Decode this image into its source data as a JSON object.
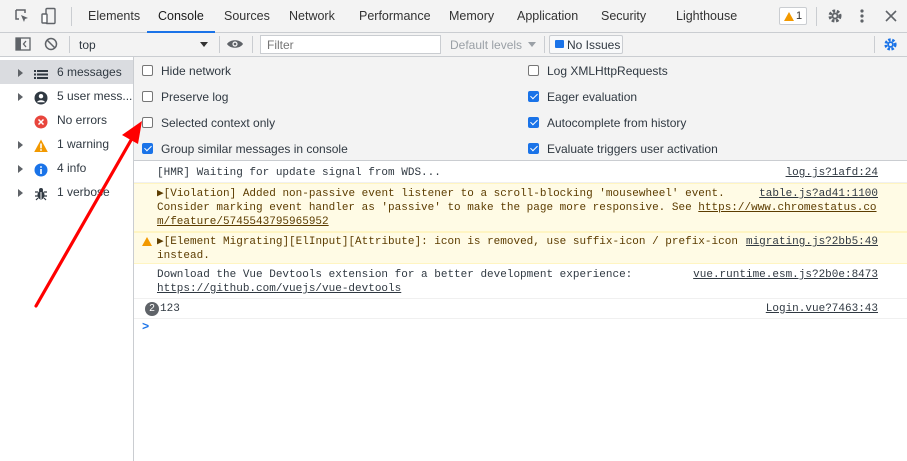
{
  "tabs": [
    "Elements",
    "Console",
    "Sources",
    "Network",
    "Performance",
    "Memory",
    "Application",
    "Security",
    "Lighthouse"
  ],
  "active_tab": "Console",
  "issues_badge": "1",
  "toolbar": {
    "context": "top",
    "filter_placeholder": "Filter",
    "levels_label": "Default levels",
    "no_issues_label": "No Issues"
  },
  "sidebar": [
    {
      "label": "6 messages",
      "icon": "list-icon"
    },
    {
      "label": "5 user mess...",
      "icon": "user-icon"
    },
    {
      "label": "No errors",
      "icon": "error-icon"
    },
    {
      "label": "1 warning",
      "icon": "warning-icon"
    },
    {
      "label": "4 info",
      "icon": "info-icon"
    },
    {
      "label": "1 verbose",
      "icon": "bug-icon"
    }
  ],
  "settings": {
    "left": [
      {
        "label": "Hide network",
        "checked": false
      },
      {
        "label": "Preserve log",
        "checked": false
      },
      {
        "label": "Selected context only",
        "checked": false
      },
      {
        "label": "Group similar messages in console",
        "checked": true
      }
    ],
    "right": [
      {
        "label": "Log XMLHttpRequests",
        "checked": false
      },
      {
        "label": "Eager evaluation",
        "checked": true
      },
      {
        "label": "Autocomplete from history",
        "checked": true
      },
      {
        "label": "Evaluate triggers user activation",
        "checked": true
      }
    ]
  },
  "messages": {
    "m1": {
      "text": "[HMR] Waiting for update signal from WDS...",
      "source": "log.js?1afd:24"
    },
    "m2": {
      "line1": "▶[Violation] Added non-passive event listener to a scroll-blocking 'mousewheel' event.",
      "line2a": "Consider marking event handler as 'passive' to make the page more responsive. See ",
      "link_a": "https://www.chromestatus.co",
      "link_b": "m/feature/5745543795965952",
      "source": "table.js?ad41:1100"
    },
    "m3": {
      "line1": "▶[Element Migrating][ElInput][Attribute]: icon is removed, use suffix-icon / prefix-icon",
      "line2": "instead.",
      "source": "migrating.js?2bb5:49"
    },
    "m4": {
      "line1": "Download the Vue Devtools extension for a better development experience:",
      "link": "https://github.com/vuejs/vue-devtools",
      "source": "vue.runtime.esm.js?2b0e:8473"
    },
    "m5": {
      "count": "2",
      "text": "123",
      "source": "Login.vue?7463:43"
    }
  },
  "prompt_symbol": ">",
  "colors": {
    "accent": "#1a73e8",
    "arrow": "#ff0000",
    "warning_bg": "#fffbe5"
  }
}
